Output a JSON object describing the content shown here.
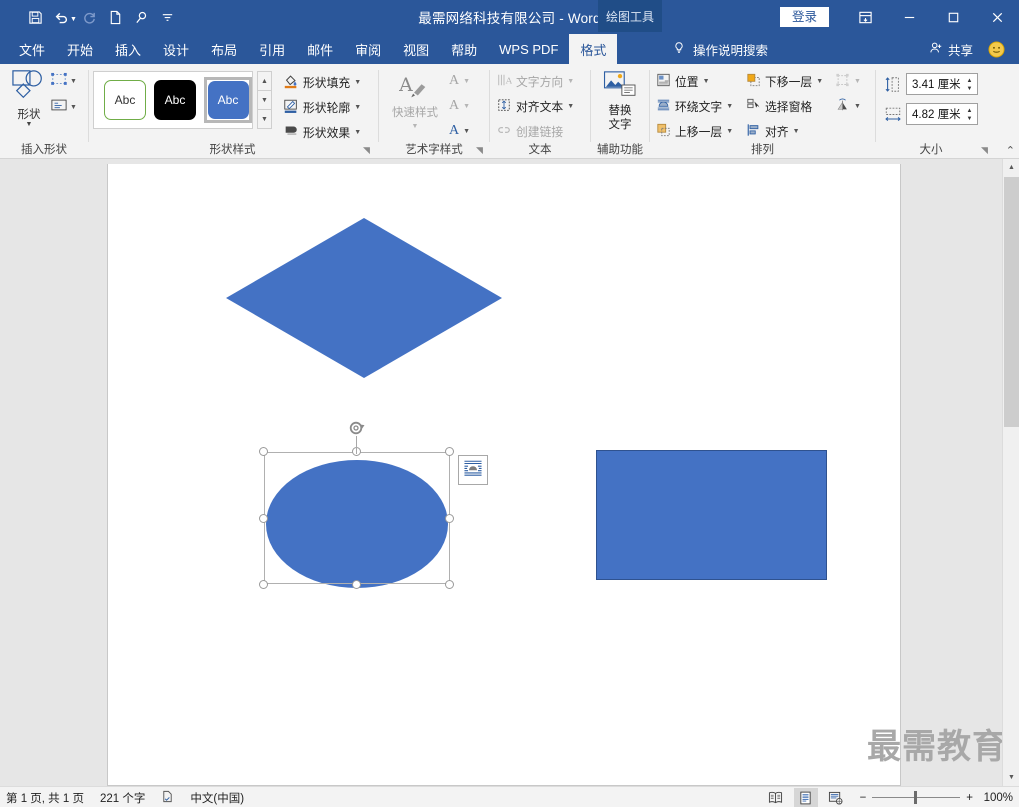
{
  "window": {
    "title": "最需网络科技有限公司 - Word",
    "contextual_tab_group": "绘图工具",
    "sign_in_label": "登录",
    "quick_access": [
      {
        "name": "save-icon",
        "label": "保存"
      },
      {
        "name": "undo-icon",
        "label": "撤销"
      },
      {
        "name": "redo-icon",
        "label": "恢复"
      },
      {
        "name": "new-document-icon",
        "label": "新建"
      },
      {
        "name": "touch-mode-icon",
        "label": "触摸/鼠标模式"
      },
      {
        "name": "customize-qat-icon",
        "label": "自定义快速访问工具栏"
      }
    ],
    "window_controls": [
      "ribbon-display-options",
      "minimize",
      "maximize",
      "close"
    ]
  },
  "tabs": [
    {
      "label": "文件",
      "active": false
    },
    {
      "label": "开始",
      "active": false
    },
    {
      "label": "插入",
      "active": false
    },
    {
      "label": "设计",
      "active": false
    },
    {
      "label": "布局",
      "active": false
    },
    {
      "label": "引用",
      "active": false
    },
    {
      "label": "邮件",
      "active": false
    },
    {
      "label": "审阅",
      "active": false
    },
    {
      "label": "视图",
      "active": false
    },
    {
      "label": "帮助",
      "active": false
    },
    {
      "label": "WPS PDF",
      "active": false
    },
    {
      "label": "格式",
      "active": true
    }
  ],
  "tell_me": "操作说明搜索",
  "share": "共享",
  "ribbon": {
    "groups": [
      {
        "name": "insert-shapes",
        "label": "插入形状",
        "shapes_button": "形状",
        "mini_buttons": [
          "edit-shape-icon",
          "text-box-icon"
        ]
      },
      {
        "name": "shape-styles",
        "label": "形状样式",
        "gallery": [
          {
            "label": "Abc",
            "style": "outline-green"
          },
          {
            "label": "Abc",
            "style": "filled-black"
          },
          {
            "label": "Abc",
            "style": "filled-blue",
            "selected": true
          }
        ],
        "buttons": [
          {
            "label": "形状填充",
            "icon": "fill-bucket-icon",
            "has_caret": true,
            "disabled": false
          },
          {
            "label": "形状轮廓",
            "icon": "outline-pen-icon",
            "has_caret": true,
            "disabled": false
          },
          {
            "label": "形状效果",
            "icon": "shape-effects-icon",
            "has_caret": true,
            "disabled": false
          }
        ]
      },
      {
        "name": "wordart-styles",
        "label": "艺术字样式",
        "quick_styles": "快速样式",
        "buttons": [
          {
            "label": "A",
            "icon": "text-fill-icon",
            "disabled": true
          },
          {
            "label": "A",
            "icon": "text-outline-icon",
            "disabled": true
          },
          {
            "label": "A",
            "icon": "text-effects-icon",
            "disabled": false
          }
        ]
      },
      {
        "name": "text",
        "label": "文本",
        "buttons": [
          {
            "label": "文字方向",
            "icon": "text-direction-icon",
            "has_caret": true,
            "disabled": true
          },
          {
            "label": "对齐文本",
            "icon": "align-text-icon",
            "has_caret": true,
            "disabled": false
          },
          {
            "label": "创建链接",
            "icon": "create-link-icon",
            "has_caret": false,
            "disabled": true
          }
        ]
      },
      {
        "name": "accessibility",
        "label": "辅助功能",
        "alt_text_button": "替换\n文字",
        "alt_text_line1": "替换",
        "alt_text_line2": "文字"
      },
      {
        "name": "arrange",
        "label": "排列",
        "annotated": true,
        "buttons": [
          {
            "label": "位置",
            "icon": "position-icon",
            "has_caret": true,
            "disabled": false
          },
          {
            "label": "环绕文字",
            "icon": "wrap-text-icon",
            "has_caret": true,
            "disabled": false
          },
          {
            "label": "上移一层",
            "icon": "bring-forward-icon",
            "has_caret": true,
            "disabled": false
          },
          {
            "label": "下移一层",
            "icon": "send-backward-icon",
            "has_caret": true,
            "disabled": false
          },
          {
            "label": "选择窗格",
            "icon": "selection-pane-icon",
            "has_caret": false,
            "disabled": false
          },
          {
            "label": "对齐",
            "icon": "align-objects-icon",
            "has_caret": true,
            "disabled": false
          },
          {
            "label": "",
            "icon": "group-objects-icon",
            "has_caret": true,
            "disabled": true
          },
          {
            "label": "",
            "icon": "rotate-objects-icon",
            "has_caret": true,
            "disabled": false
          }
        ]
      },
      {
        "name": "size",
        "label": "大小",
        "height": {
          "icon": "shape-height-icon",
          "value": "3.41 厘米"
        },
        "width": {
          "icon": "shape-width-icon",
          "value": "4.82 厘米"
        }
      }
    ],
    "collapse_tooltip": "折叠功能区"
  },
  "document": {
    "shapes": [
      {
        "name": "diamond-shape",
        "type": "diamond",
        "fill": "#4472C4",
        "selected": false
      },
      {
        "name": "ellipse-shape",
        "type": "ellipse",
        "fill": "#4472C4",
        "selected": true
      },
      {
        "name": "rectangle-shape",
        "type": "rectangle",
        "fill": "#4472C4",
        "border": "#2F528F",
        "selected": false
      }
    ],
    "layout_options_icon": "layout-options-tight-wrap-icon",
    "rotate_handle_icon": "rotate-handle-icon",
    "watermark": "最需教育"
  },
  "status_bar": {
    "page_info": "第 1 页, 共 1 页",
    "word_count": "221 个字",
    "proofing_icon": "proofing-errors-icon",
    "language": "中文(中国)",
    "views": [
      {
        "name": "read-mode-view",
        "label": "阅读视图",
        "selected": false
      },
      {
        "name": "print-layout-view",
        "label": "页面视图",
        "selected": true
      },
      {
        "name": "web-layout-view",
        "label": "Web 版式视图",
        "selected": false
      }
    ],
    "zoom_out": "−",
    "zoom_in": "+",
    "zoom_level": "100%"
  },
  "colors": {
    "title_bar": "#2B579A",
    "contextual_tab": "#204D87",
    "ribbon_bg": "#F3F3F3",
    "shape_fill": "#4472C4",
    "annotation": "#E8302C",
    "workspace": "#E6E6E6"
  }
}
